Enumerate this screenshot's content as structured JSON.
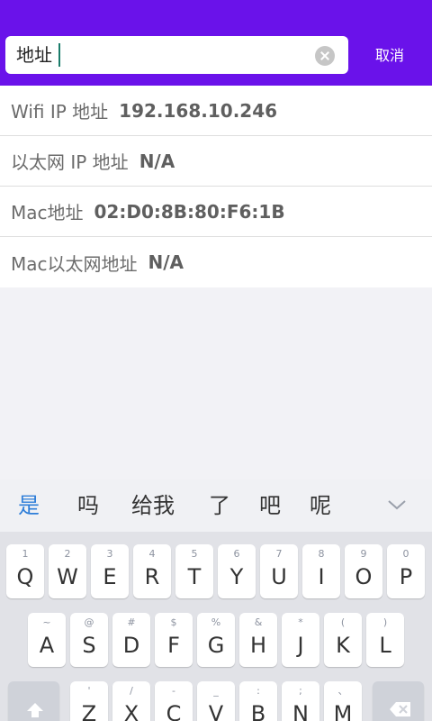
{
  "search": {
    "query": "地址",
    "cancel_label": "取消"
  },
  "results": [
    {
      "label": "Wifi IP 地址",
      "value": "192.168.10.246"
    },
    {
      "label": "以太网 IP 地址",
      "value": "N/A"
    },
    {
      "label": "Mac地址",
      "value": "02:D0:8B:80:F6:1B"
    },
    {
      "label": "Mac以太网地址",
      "value": "N/A"
    }
  ],
  "keyboard": {
    "candidates": [
      "是",
      "吗",
      "给我",
      "了",
      "吧",
      "呢"
    ],
    "row1": [
      {
        "hint": "1",
        "key": "Q"
      },
      {
        "hint": "2",
        "key": "W"
      },
      {
        "hint": "3",
        "key": "E"
      },
      {
        "hint": "4",
        "key": "R"
      },
      {
        "hint": "5",
        "key": "T"
      },
      {
        "hint": "6",
        "key": "Y"
      },
      {
        "hint": "7",
        "key": "U"
      },
      {
        "hint": "8",
        "key": "I"
      },
      {
        "hint": "9",
        "key": "O"
      },
      {
        "hint": "0",
        "key": "P"
      }
    ],
    "row2": [
      {
        "hint": "~",
        "key": "A"
      },
      {
        "hint": "@",
        "key": "S"
      },
      {
        "hint": "#",
        "key": "D"
      },
      {
        "hint": "$",
        "key": "F"
      },
      {
        "hint": "%",
        "key": "G"
      },
      {
        "hint": "&",
        "key": "H"
      },
      {
        "hint": "*",
        "key": "J"
      },
      {
        "hint": "(",
        "key": "K"
      },
      {
        "hint": ")",
        "key": "L"
      }
    ],
    "row3": [
      {
        "hint": "'",
        "key": "Z"
      },
      {
        "hint": "/",
        "key": "X"
      },
      {
        "hint": "-",
        "key": "C"
      },
      {
        "hint": "_",
        "key": "V"
      },
      {
        "hint": ":",
        "key": "B"
      },
      {
        "hint": ";",
        "key": "N"
      },
      {
        "hint": "、",
        "key": "M"
      }
    ]
  },
  "colors": {
    "header": "#6a12ea",
    "candidate_active": "#2e7ed8",
    "caret": "#1a7c6a"
  }
}
